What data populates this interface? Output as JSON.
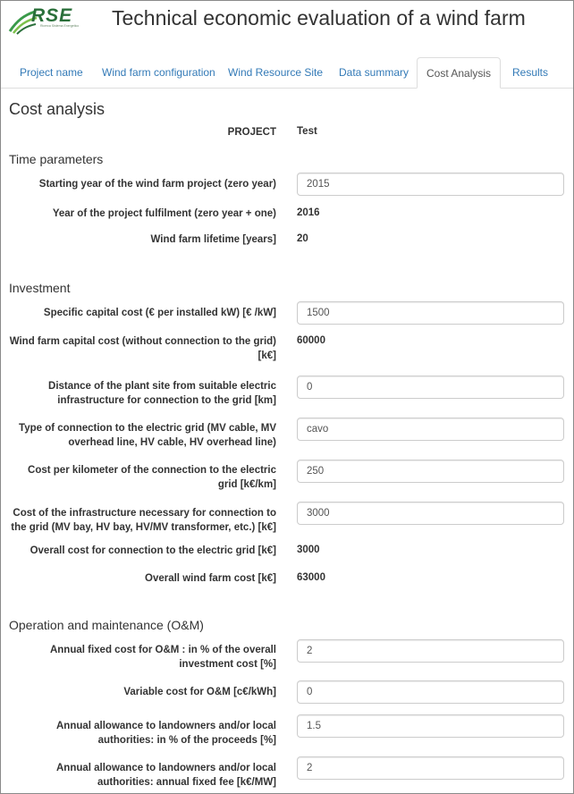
{
  "header": {
    "logo_text": "RSE",
    "logo_subtitle": "Ricerca Sistema Energetico",
    "title": "Technical economic evaluation of a wind farm"
  },
  "tabs": [
    {
      "label": "Project name"
    },
    {
      "label": "Wind farm configuration"
    },
    {
      "label": "Wind Resource Site"
    },
    {
      "label": "Data summary"
    },
    {
      "label": "Cost Analysis",
      "active": true
    },
    {
      "label": "Results"
    }
  ],
  "page": {
    "title": "Cost analysis",
    "project_label": "PROJECT",
    "project_value": "Test"
  },
  "time": {
    "heading": "Time parameters",
    "start_year_label": "Starting year of the wind farm project (zero year)",
    "start_year_value": "2015",
    "fulfilment_label": "Year of the project fulfilment (zero year + one)",
    "fulfilment_value": "2016",
    "lifetime_label": "Wind farm lifetime [years]",
    "lifetime_value": "20"
  },
  "investment": {
    "heading": "Investment",
    "specific_cost_label": "Specific capital cost (€ per installed kW) [€ /kW]",
    "specific_cost_value": "1500",
    "farm_cost_label": "Wind farm capital cost (without connection to the grid) [k€]",
    "farm_cost_value": "60000",
    "distance_label": "Distance of the plant site from suitable electric infrastructure for connection to the grid [km]",
    "distance_value": "0",
    "connection_type_label": "Type of connection to the electric grid (MV cable, MV overhead line, HV cable, HV overhead line)",
    "connection_type_value": "cavo",
    "cost_per_km_label": "Cost per kilometer of the connection to the electric grid [k€/km]",
    "cost_per_km_value": "250",
    "infra_cost_label": "Cost of the infrastructure necessary for connection to the grid (MV bay, HV bay, HV/MV transformer, etc.) [k€]",
    "infra_cost_value": "3000",
    "overall_connection_label": "Overall cost for connection to the electric grid [k€]",
    "overall_connection_value": "3000",
    "overall_farm_label": "Overall wind farm cost [k€]",
    "overall_farm_value": "63000"
  },
  "om": {
    "heading": "Operation and maintenance (O&M)",
    "fixed_cost_label": "Annual fixed cost for O&M : in % of the overall investment cost [%]",
    "fixed_cost_value": "2",
    "variable_cost_label": "Variable cost for O&M [c€/kWh]",
    "variable_cost_value": "0",
    "allowance_pct_label": "Annual allowance to landowners and/or local authorities: in % of the proceeds [%]",
    "allowance_pct_value": "1.5",
    "allowance_fee_label": "Annual allowance to landowners and/or local authorities: annual fixed fee [k€/MW]",
    "allowance_fee_value": "2"
  }
}
